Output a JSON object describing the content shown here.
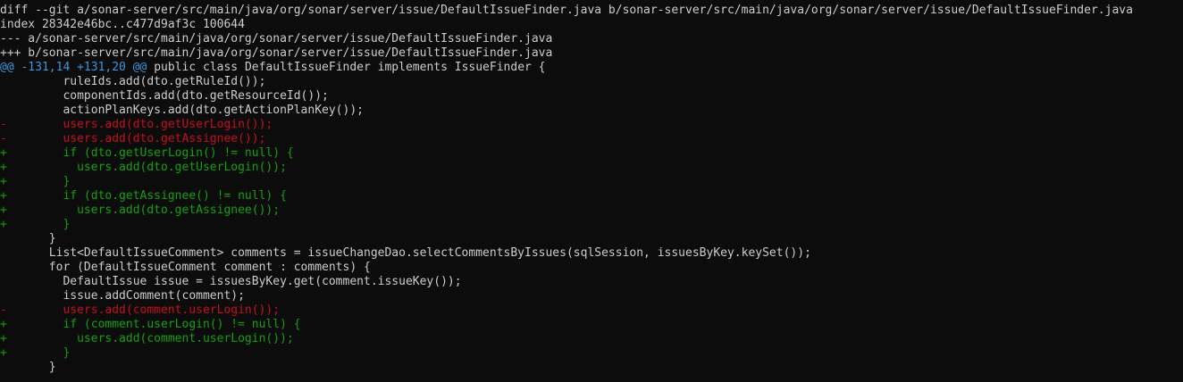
{
  "terminal": {
    "header": [
      "diff --git a/sonar-server/src/main/java/org/sonar/server/issue/DefaultIssueFinder.java b/sonar-server/src/main/java/org/sonar/server/issue/DefaultIssueFinder.java",
      "index 28342e46bc..c477d9af3c 100644",
      "--- a/sonar-server/src/main/java/org/sonar/server/issue/DefaultIssueFinder.java",
      "+++ b/sonar-server/src/main/java/org/sonar/server/issue/DefaultIssueFinder.java"
    ],
    "hunk": {
      "range": "@@ -131,14 +131,20 @@",
      "context": " public class DefaultIssueFinder implements IssueFinder {"
    },
    "lines": [
      {
        "type": "context",
        "text": "         ruleIds.add(dto.getRuleId());"
      },
      {
        "type": "context",
        "text": "         componentIds.add(dto.getResourceId());"
      },
      {
        "type": "context",
        "text": "         actionPlanKeys.add(dto.getActionPlanKey());"
      },
      {
        "type": "removed",
        "text": "-        users.add(dto.getUserLogin());"
      },
      {
        "type": "removed",
        "text": "-        users.add(dto.getAssignee());"
      },
      {
        "type": "added",
        "text": "+        if (dto.getUserLogin() != null) {"
      },
      {
        "type": "added",
        "text": "+          users.add(dto.getUserLogin());"
      },
      {
        "type": "added",
        "text": "+        }"
      },
      {
        "type": "added",
        "text": "+        if (dto.getAssignee() != null) {"
      },
      {
        "type": "added",
        "text": "+          users.add(dto.getAssignee());"
      },
      {
        "type": "added",
        "text": "+        }"
      },
      {
        "type": "context",
        "text": "       }"
      },
      {
        "type": "context",
        "text": "       List<DefaultIssueComment> comments = issueChangeDao.selectCommentsByIssues(sqlSession, issuesByKey.keySet());"
      },
      {
        "type": "context",
        "text": "       for (DefaultIssueComment comment : comments) {"
      },
      {
        "type": "context",
        "text": "         DefaultIssue issue = issuesByKey.get(comment.issueKey());"
      },
      {
        "type": "context",
        "text": "         issue.addComment(comment);"
      },
      {
        "type": "removed",
        "text": "-        users.add(comment.userLogin());"
      },
      {
        "type": "added",
        "text": "+        if (comment.userLogin() != null) {"
      },
      {
        "type": "added",
        "text": "+          users.add(comment.userLogin());"
      },
      {
        "type": "added",
        "text": "+        }"
      },
      {
        "type": "context",
        "text": "       }"
      }
    ]
  },
  "colors": {
    "background": "#0c0c0c",
    "text": "#cccccc",
    "hunk": "#3a96dd",
    "removed": "#c50f1f",
    "added": "#13a10e"
  }
}
